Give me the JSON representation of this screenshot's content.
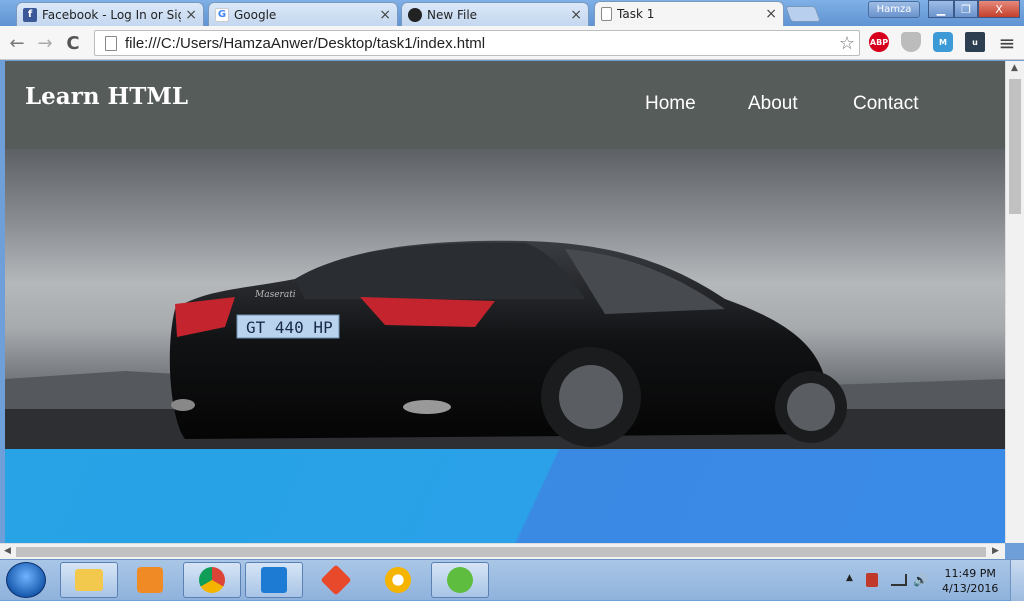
{
  "window": {
    "profile_name": "Hamza",
    "controls": {
      "minimize": "▁",
      "maximize": "❐",
      "close": "X"
    }
  },
  "tabs": [
    {
      "title": "Facebook - Log In or Sign Up",
      "favicon": "facebook-icon",
      "fav_glyph": "f",
      "fav_color": "#3b5998",
      "active": false
    },
    {
      "title": "Google",
      "favicon": "google-icon",
      "fav_glyph": "G",
      "fav_color": "#ffffff",
      "active": false
    },
    {
      "title": "New File",
      "favicon": "github-icon",
      "fav_glyph": "●",
      "fav_color": "#222222",
      "active": false
    },
    {
      "title": "Task 1",
      "favicon": "page-icon",
      "fav_glyph": "",
      "fav_color": "#ffffff",
      "active": true
    }
  ],
  "tab_close": "×",
  "toolbar": {
    "back": "←",
    "forward": "→",
    "reload": "C",
    "url": "file:///C:/Users/HamzaAnwer/Desktop/task1/index.html",
    "bookmark": "☆",
    "menu": "≡",
    "extensions": [
      {
        "name": "adblock-plus-icon",
        "label": "ABP",
        "color": "#d6001c"
      },
      {
        "name": "shield-extension-icon",
        "label": "",
        "color": "#bcbcbc"
      },
      {
        "name": "mailtrack-extension-icon",
        "label": "M",
        "color": "#3c9bd6"
      },
      {
        "name": "u-extension-icon",
        "label": "u",
        "color": "#2c3e50"
      }
    ]
  },
  "site": {
    "brand": "Learn HTML",
    "nav": [
      "Home",
      "About",
      "Contact"
    ],
    "hero_plate": "GT 440 HP",
    "hero_badge": "Maserati"
  },
  "taskbar": {
    "apps": [
      {
        "name": "explorer-icon",
        "color": "#f2c94c",
        "open": true
      },
      {
        "name": "media-player-icon",
        "color": "#f08a24",
        "open": false
      },
      {
        "name": "chrome-icon",
        "color": "#db4437",
        "open": true
      },
      {
        "name": "visual-studio-code-icon",
        "color": "#1e7bd3",
        "open": true
      },
      {
        "name": "git-icon",
        "color": "#e8492b",
        "open": false
      },
      {
        "name": "chrome-canary-icon",
        "color": "#f5b400",
        "open": false
      },
      {
        "name": "utorrent-icon",
        "color": "#5ebd3e",
        "open": true
      }
    ],
    "tray": {
      "expand": "▲",
      "volume": "🔊"
    },
    "time": "11:49 PM",
    "date": "4/13/2016"
  }
}
